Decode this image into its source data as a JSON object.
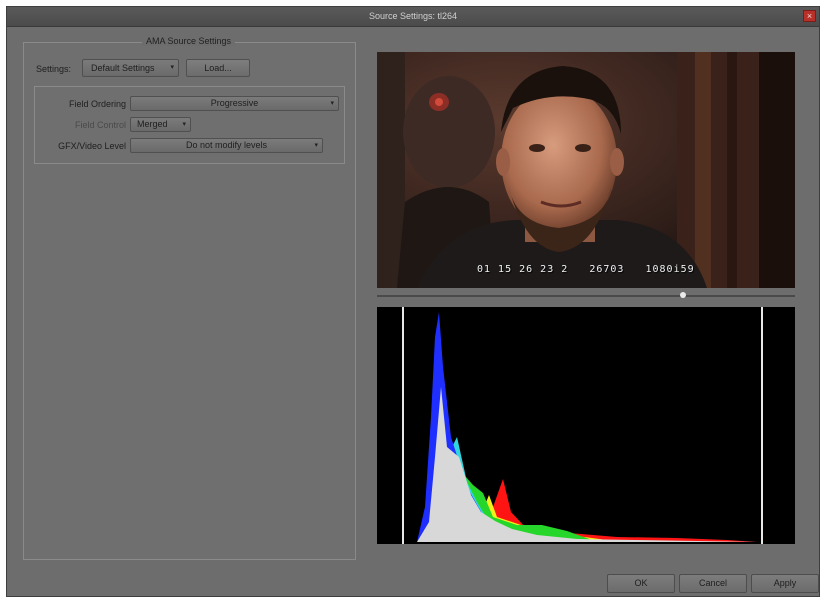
{
  "window": {
    "title": "Source Settings: tl264",
    "close_glyph": "×"
  },
  "panel": {
    "title": "AMA Source Settings",
    "settings_label": "Settings:",
    "settings_value": "Default Settings",
    "load_button": "Load..."
  },
  "fields": {
    "field_ordering": {
      "label": "Field Ordering",
      "value": "Progressive"
    },
    "field_control": {
      "label": "Field Control",
      "value": "Merged"
    },
    "rgb_video_level": {
      "label": "GFX/Video Level",
      "value": "Do not modify levels"
    }
  },
  "preview": {
    "timecode": "01 15 26 23 2   26703   1080i59"
  },
  "scrubber": {
    "position": 0.73
  },
  "histogram": {
    "colors": {
      "luma": "#d8d8d8",
      "blue": "#1f2fff",
      "cyan": "#2fd6e0",
      "green": "#27d62a",
      "yellow": "#f2f21a",
      "red": "#ff1414",
      "magenta": "#e020e0"
    }
  },
  "footer": {
    "ok": "OK",
    "cancel": "Cancel",
    "apply": "Apply"
  }
}
